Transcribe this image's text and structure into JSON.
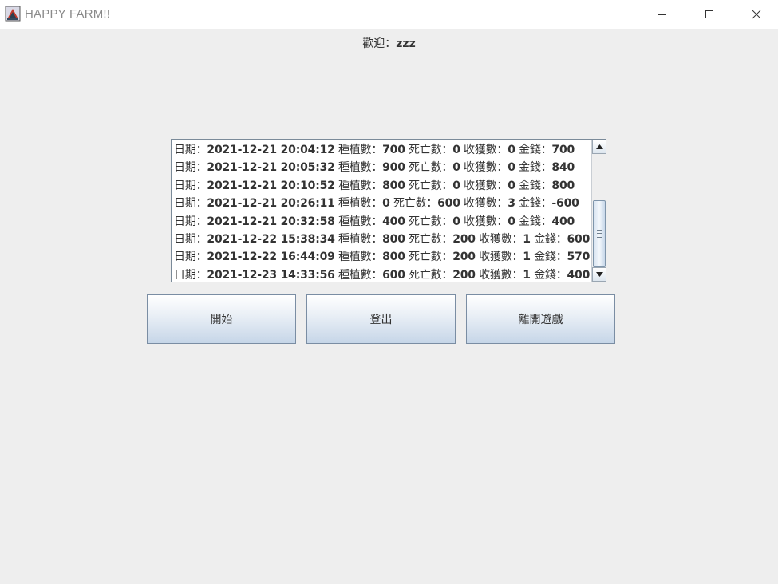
{
  "window": {
    "title": "HAPPY FARM!!",
    "icon": "java-cup-icon",
    "controls": [
      "minimize-icon",
      "maximize-icon",
      "close-icon"
    ]
  },
  "welcome": {
    "label": "歡迎：",
    "username": "zzz"
  },
  "records": [
    {
      "date_label": "日期：",
      "date": "2021-12-21 20:04:12",
      "plant_label": " 種植數：",
      "plant": "700",
      "dead_label": " 死亡數：",
      "dead": "0",
      "harvest_label": " 收獲數：",
      "harvest": "0",
      "money_label": " 金錢：",
      "money": "700"
    },
    {
      "date_label": "日期：",
      "date": "2021-12-21 20:05:32",
      "plant_label": " 種植數：",
      "plant": "900",
      "dead_label": " 死亡數：",
      "dead": "0",
      "harvest_label": " 收獲數：",
      "harvest": "0",
      "money_label": " 金錢：",
      "money": "840"
    },
    {
      "date_label": "日期：",
      "date": "2021-12-21 20:10:52",
      "plant_label": " 種植數：",
      "plant": "800",
      "dead_label": " 死亡數：",
      "dead": "0",
      "harvest_label": " 收獲數：",
      "harvest": "0",
      "money_label": " 金錢：",
      "money": "800"
    },
    {
      "date_label": "日期：",
      "date": "2021-12-21 20:26:11",
      "plant_label": " 種植數：",
      "plant": "0",
      "dead_label": " 死亡數：",
      "dead": "600",
      "harvest_label": " 收獲數：",
      "harvest": "3",
      "money_label": " 金錢：",
      "money": "-600"
    },
    {
      "date_label": "日期：",
      "date": "2021-12-21 20:32:58",
      "plant_label": " 種植數：",
      "plant": "400",
      "dead_label": " 死亡數：",
      "dead": "0",
      "harvest_label": " 收獲數：",
      "harvest": "0",
      "money_label": " 金錢：",
      "money": "400"
    },
    {
      "date_label": "日期：",
      "date": "2021-12-22 15:38:34",
      "plant_label": " 種植數：",
      "plant": "800",
      "dead_label": " 死亡數：",
      "dead": "200",
      "harvest_label": " 收獲數：",
      "harvest": "1",
      "money_label": " 金錢：",
      "money": "600"
    },
    {
      "date_label": "日期：",
      "date": "2021-12-22 16:44:09",
      "plant_label": " 種植數：",
      "plant": "800",
      "dead_label": " 死亡數：",
      "dead": "200",
      "harvest_label": " 收獲數：",
      "harvest": "1",
      "money_label": " 金錢：",
      "money": "570"
    },
    {
      "date_label": "日期：",
      "date": "2021-12-23 14:33:56",
      "plant_label": " 種植數：",
      "plant": "600",
      "dead_label": " 死亡數：",
      "dead": "200",
      "harvest_label": " 收獲數：",
      "harvest": "1",
      "money_label": " 金錢：",
      "money": "400"
    }
  ],
  "buttons": {
    "start": "開始",
    "logout": "登出",
    "exit": "離開遊戲"
  }
}
